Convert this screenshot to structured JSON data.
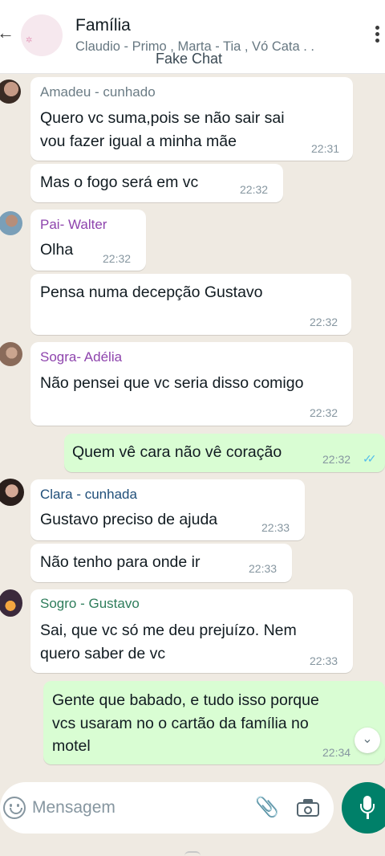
{
  "header": {
    "title": "Família",
    "subtitle": "Claudio - Primo , Marta - Tia , Vó Cata . .",
    "watermark": "Fake Chat"
  },
  "messages": [
    {
      "sender": "Amadeu - cunhado",
      "sender_color": "#6b7c85",
      "lines": [
        "Quero vc suma,pois se não  sair sai",
        "vou fazer igual a minha mãe"
      ],
      "time": "22:31"
    },
    {
      "sender": "",
      "lines": [
        "Mas o fogo será em vc"
      ],
      "time": "22:32"
    },
    {
      "sender": "Pai- Walter",
      "sender_color": "#8e44ad",
      "lines": [
        "Olha"
      ],
      "time": "22:32"
    },
    {
      "sender": "",
      "lines": [
        "Pensa numa decepção Gustavo"
      ],
      "time": "22:32"
    },
    {
      "sender": "Sogra- Adélia",
      "sender_color": "#8e44ad",
      "lines": [
        "Não pensei que vc seria disso comigo"
      ],
      "time": "22:32"
    },
    {
      "sender": "",
      "outgoing": true,
      "lines": [
        "Quem vê cara não vê coração"
      ],
      "time": "22:32"
    },
    {
      "sender": "Clara - cunhada",
      "sender_color": "#1f4e79",
      "lines": [
        "Gustavo preciso de ajuda"
      ],
      "time": "22:33"
    },
    {
      "sender": "",
      "lines": [
        "Não tenho para onde ir"
      ],
      "time": "22:33"
    },
    {
      "sender": "Sogro - Gustavo",
      "sender_color": "#2e7d5b",
      "lines": [
        "Sai, que vc só me deu prejuízo. Nem",
        "quero saber de vc"
      ],
      "time": "22:33"
    },
    {
      "sender": "",
      "outgoing": true,
      "lines": [
        "Gente que babado, e tudo isso porque",
        "vcs usaram no o cartão da família no",
        "motel"
      ],
      "time": "22:34"
    }
  ],
  "composer": {
    "placeholder": "Mensagem"
  },
  "colors": {
    "accent": "#008069",
    "outgoing_bubble": "#d9fdd3",
    "read_checks": "#53bdeb",
    "chat_background": "#efeae2"
  }
}
